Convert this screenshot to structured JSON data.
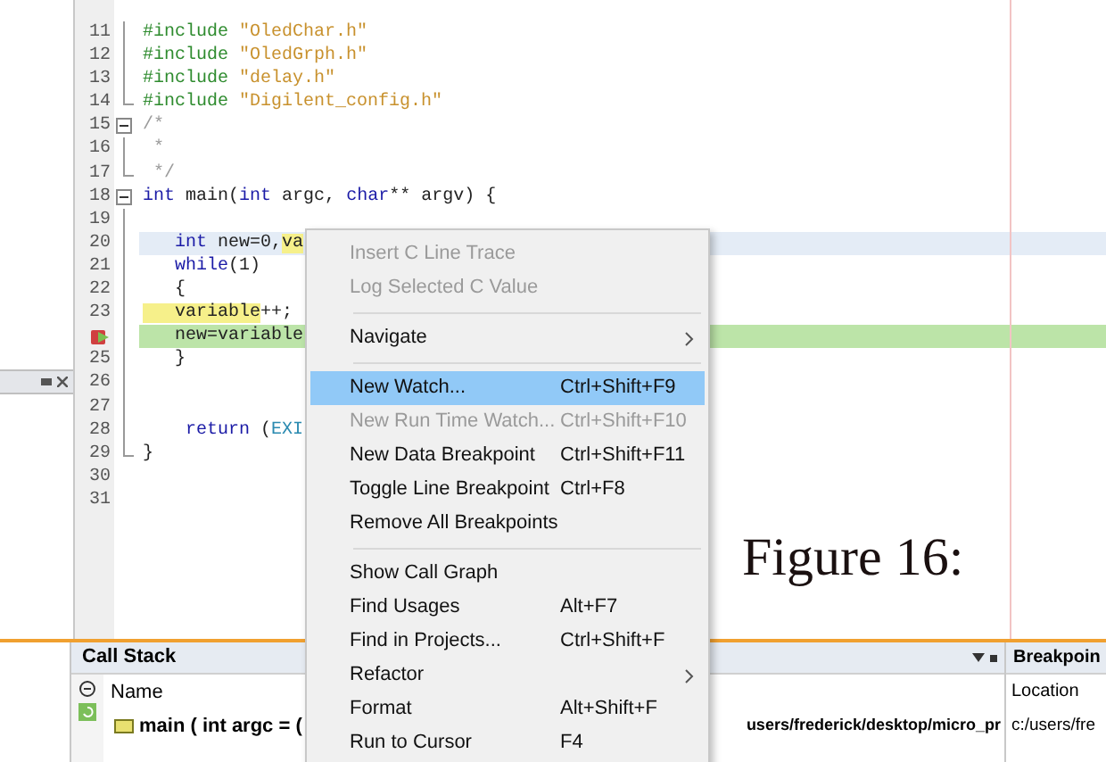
{
  "editor": {
    "lines": [
      {
        "number": "11",
        "kind": "fold_line",
        "segments": [
          {
            "kind": "preprocessor",
            "text": "#include"
          },
          {
            "kind": "string",
            "text": " \"OledChar.h\""
          }
        ]
      },
      {
        "number": "12",
        "kind": "fold_line",
        "segments": [
          {
            "kind": "preprocessor",
            "text": "#include"
          },
          {
            "kind": "string",
            "text": " \"OledGrph.h\""
          }
        ]
      },
      {
        "number": "13",
        "kind": "fold_line",
        "segments": [
          {
            "kind": "preprocessor",
            "text": "#include"
          },
          {
            "kind": "string",
            "text": " \"delay.h\""
          }
        ]
      },
      {
        "number": "14",
        "kind": "fold_end",
        "segments": [
          {
            "kind": "preprocessor",
            "text": "#include"
          },
          {
            "kind": "string",
            "text": " \"Digilent_config.h\""
          }
        ]
      },
      {
        "number": "15",
        "kind": "fold_start",
        "segments": [
          {
            "kind": "comment",
            "text": "/*"
          }
        ]
      },
      {
        "number": "16",
        "kind": "fold_line",
        "segments": [
          {
            "kind": "comment",
            "text": " *"
          }
        ]
      },
      {
        "number": "17",
        "kind": "fold_end",
        "segments": [
          {
            "kind": "comment",
            "text": " */"
          }
        ]
      },
      {
        "number": "18",
        "kind": "fold_start",
        "segments": [
          {
            "kind": "keyword",
            "text": "int"
          },
          {
            "kind": "plain",
            "text": " main("
          },
          {
            "kind": "keyword",
            "text": "int"
          },
          {
            "kind": "plain",
            "text": " argc, "
          },
          {
            "kind": "keyword",
            "text": "char"
          },
          {
            "kind": "plain",
            "text": "** argv) {"
          }
        ]
      },
      {
        "number": "19",
        "kind": "fold_line"
      },
      {
        "number": "20",
        "kind": "fold_line",
        "current": true,
        "executing": false,
        "segments": [
          {
            "kind": "keyword",
            "text": "   int"
          },
          {
            "kind": "plain",
            "text": " new=0,"
          },
          {
            "kind": "occurrence",
            "text": "va"
          }
        ]
      },
      {
        "number": "21",
        "kind": "fold_line",
        "segments": [
          {
            "kind": "keyword",
            "text": "   while"
          },
          {
            "kind": "plain",
            "text": "(1)"
          }
        ]
      },
      {
        "number": "22",
        "kind": "fold_line",
        "segments": [
          {
            "kind": "plain",
            "text": "   {"
          }
        ]
      },
      {
        "number": "23",
        "kind": "fold_line",
        "segments": [
          {
            "kind": "occurrence",
            "text": "   variable"
          },
          {
            "kind": "plain",
            "text": "++;"
          }
        ]
      },
      {
        "kind": "fold_line",
        "current": false,
        "executing": true,
        "segments": [
          {
            "kind": "plain",
            "text": "   new=variable"
          }
        ]
      },
      {
        "number": "25",
        "kind": "fold_line",
        "segments": [
          {
            "kind": "plain",
            "text": "   }"
          }
        ]
      },
      {
        "number": "26",
        "kind": "fold_line"
      },
      {
        "number": "27",
        "kind": "fold_line"
      },
      {
        "number": "28",
        "kind": "fold_line",
        "segments": [
          {
            "kind": "keyword",
            "text": "    return"
          },
          {
            "kind": "plain",
            "text": " ("
          },
          {
            "kind": "constant",
            "text": "EXI"
          }
        ]
      },
      {
        "number": "29",
        "kind": "fold_end",
        "segments": [
          {
            "kind": "plain",
            "text": "}"
          }
        ]
      },
      {
        "number": "30",
        "kind": "plain"
      },
      {
        "number": "31",
        "kind": "plain"
      }
    ]
  },
  "context_menu": [
    {
      "kind": "item",
      "label": "Insert C Line Trace",
      "disabled": true,
      "selected": false
    },
    {
      "kind": "item",
      "label": "Log Selected C Value",
      "disabled": true,
      "selected": false
    },
    {
      "kind": "separator"
    },
    {
      "kind": "item",
      "label": "Navigate",
      "disabled": false,
      "selected": false,
      "submenu": true
    },
    {
      "kind": "separator"
    },
    {
      "kind": "item",
      "label": "New Watch...",
      "shortcut": "Ctrl+Shift+F9",
      "disabled": false,
      "selected": true
    },
    {
      "kind": "item",
      "label": "New Run Time Watch...",
      "shortcut": "Ctrl+Shift+F10",
      "disabled": true,
      "selected": false
    },
    {
      "kind": "item",
      "label": "New Data Breakpoint",
      "shortcut": "Ctrl+Shift+F11",
      "disabled": false,
      "selected": false
    },
    {
      "kind": "item",
      "label": "Toggle Line Breakpoint",
      "shortcut": "Ctrl+F8",
      "disabled": false,
      "selected": false
    },
    {
      "kind": "item",
      "label": "Remove All Breakpoints",
      "disabled": false,
      "selected": false
    },
    {
      "kind": "separator"
    },
    {
      "kind": "item",
      "label": "Show Call Graph",
      "disabled": false,
      "selected": false
    },
    {
      "kind": "item",
      "label": "Find Usages",
      "shortcut": "Alt+F7",
      "disabled": false,
      "selected": false
    },
    {
      "kind": "item",
      "label": "Find in Projects...",
      "shortcut": "Ctrl+Shift+F",
      "disabled": false,
      "selected": false
    },
    {
      "kind": "item",
      "label": "Refactor",
      "disabled": false,
      "selected": false,
      "submenu": true
    },
    {
      "kind": "item",
      "label": "Format",
      "shortcut": "Alt+Shift+F",
      "disabled": false,
      "selected": false
    },
    {
      "kind": "item",
      "label": "Run to Cursor",
      "shortcut": "F4",
      "disabled": false,
      "selected": false
    }
  ],
  "call_stack": {
    "title": "Call Stack",
    "column": "Name",
    "row": {
      "name": "main ( int argc = (",
      "location": "users/frederick/desktop/micro_pr"
    }
  },
  "breakpoints": {
    "title": "Breakpoin",
    "column": "Location",
    "row": {
      "location": "c:/users/fre"
    }
  },
  "figure_caption": "Figure 16:"
}
